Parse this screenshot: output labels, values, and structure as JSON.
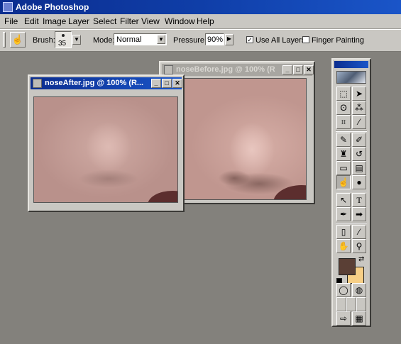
{
  "app": {
    "title": "Adobe Photoshop"
  },
  "menu": [
    "File",
    "Edit",
    "Image",
    "Layer",
    "Select",
    "Filter",
    "View",
    "Window",
    "Help"
  ],
  "options": {
    "brush_label": "Brush:",
    "brush_size": "35",
    "mode_label": "Mode:",
    "mode_value": "Normal",
    "pressure_label": "Pressure:",
    "pressure_value": "90%",
    "use_all_layers_label": "Use All Layers",
    "use_all_layers_checked": true,
    "finger_painting_label": "Finger Painting",
    "finger_painting_checked": false
  },
  "windows": {
    "before": {
      "title": "noseBefore.jpg @ 100% (R"
    },
    "after": {
      "title": "noseAfter.jpg @ 100% (R..."
    }
  },
  "window_buttons": {
    "minimize": "_",
    "maximize": "□",
    "close": "✕"
  },
  "toolbox": {
    "tools": [
      {
        "name": "marquee-tool-icon",
        "glyph": "⬚"
      },
      {
        "name": "move-tool-icon",
        "glyph": "➤"
      },
      {
        "name": "lasso-tool-icon",
        "glyph": "ʘ"
      },
      {
        "name": "magic-wand-tool-icon",
        "glyph": "⁂"
      },
      {
        "name": "crop-tool-icon",
        "glyph": "⌗"
      },
      {
        "name": "slice-tool-icon",
        "glyph": "⁄"
      },
      {
        "name": "airbrush-tool-icon",
        "glyph": "✎"
      },
      {
        "name": "paintbrush-tool-icon",
        "glyph": "✐"
      },
      {
        "name": "rubber-stamp-tool-icon",
        "glyph": "♜"
      },
      {
        "name": "history-brush-tool-icon",
        "glyph": "↺"
      },
      {
        "name": "eraser-tool-icon",
        "glyph": "▭"
      },
      {
        "name": "gradient-tool-icon",
        "glyph": "▤"
      },
      {
        "name": "smudge-tool-icon",
        "glyph": "☝"
      },
      {
        "name": "burn-tool-icon",
        "glyph": "●"
      },
      {
        "name": "path-selection-tool-icon",
        "glyph": "↖"
      },
      {
        "name": "type-tool-icon",
        "glyph": "T"
      },
      {
        "name": "pen-tool-icon",
        "glyph": "✒"
      },
      {
        "name": "shape-tool-icon",
        "glyph": "➡"
      },
      {
        "name": "notes-tool-icon",
        "glyph": "▯"
      },
      {
        "name": "eyedropper-tool-icon",
        "glyph": "⁄"
      },
      {
        "name": "hand-tool-icon",
        "glyph": "✋"
      },
      {
        "name": "zoom-tool-icon",
        "glyph": "⚲"
      }
    ],
    "active_tool": "smudge-tool-icon",
    "foreground_color": "#5a3f35",
    "background_color": "#f7cf86"
  },
  "colors": {
    "title_bar": "#0f3ea8",
    "workspace": "#83817c",
    "chrome": "#c9c7c2"
  }
}
